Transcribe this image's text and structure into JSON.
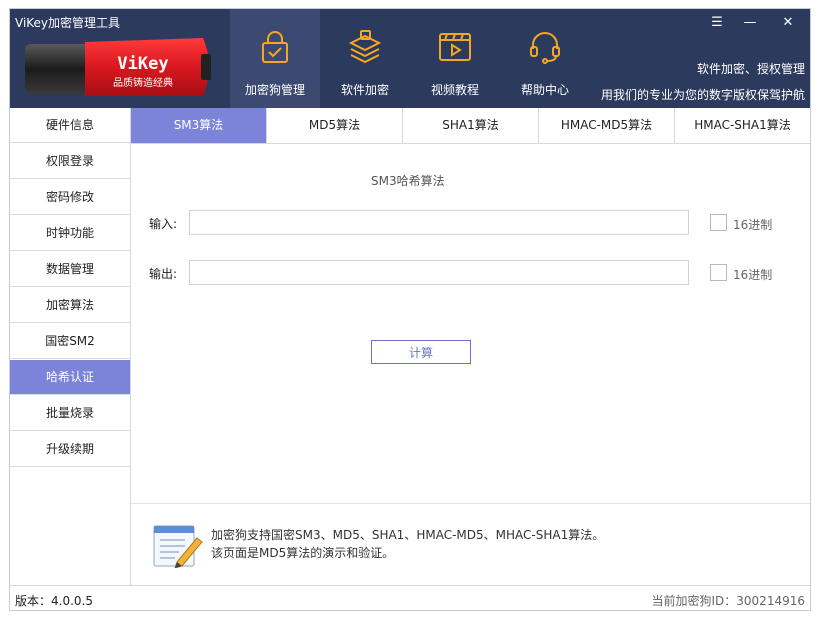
{
  "window": {
    "title": "ViKey加密管理工具"
  },
  "logo": {
    "brand": "ViKey",
    "tagline": "品质铸造经典"
  },
  "nav": [
    {
      "label": "加密狗管理",
      "icon": "lock-icon",
      "active": true
    },
    {
      "label": "软件加密",
      "icon": "layers-lock-icon",
      "active": false
    },
    {
      "label": "视频教程",
      "icon": "video-play-icon",
      "active": false
    },
    {
      "label": "帮助中心",
      "icon": "headset-icon",
      "active": false
    }
  ],
  "window_controls": {
    "menu": "☰",
    "minimize": "—",
    "close": "✕"
  },
  "slogan": {
    "line1": "软件加密、授权管理",
    "line2": "用我们的专业为您的数字版权保驾护航"
  },
  "sidebar": {
    "items": [
      {
        "label": "硬件信息",
        "active": false
      },
      {
        "label": "权限登录",
        "active": false
      },
      {
        "label": "密码修改",
        "active": false
      },
      {
        "label": "时钟功能",
        "active": false
      },
      {
        "label": "数据管理",
        "active": false
      },
      {
        "label": "加密算法",
        "active": false
      },
      {
        "label": "国密SM2",
        "active": false
      },
      {
        "label": "哈希认证",
        "active": true
      },
      {
        "label": "批量烧录",
        "active": false
      },
      {
        "label": "升级续期",
        "active": false
      }
    ]
  },
  "tabs": [
    {
      "label": "SM3算法",
      "active": true
    },
    {
      "label": "MD5算法",
      "active": false
    },
    {
      "label": "SHA1算法",
      "active": false
    },
    {
      "label": "HMAC-MD5算法",
      "active": false
    },
    {
      "label": "HMAC-SHA1算法",
      "active": false
    }
  ],
  "form": {
    "title": "SM3哈希算法",
    "input_label": "输入:",
    "input_value": "",
    "output_label": "输出:",
    "output_value": "",
    "hex_label": "16进制",
    "hex_input_checked": false,
    "hex_output_checked": false,
    "calc_label": "计算"
  },
  "info": {
    "line1": "加密狗支持国密SM3、MD5、SHA1、HMAC-MD5、MHAC-SHA1算法。",
    "line2": "该页面是MD5算法的演示和验证。"
  },
  "status": {
    "version": "版本：4.0.0.5",
    "dongle_id": "当前加密狗ID：300214916"
  },
  "colors": {
    "header_bg": "#2c3a5e",
    "accent": "#7b84d9",
    "logo_red": "#e0242b"
  }
}
